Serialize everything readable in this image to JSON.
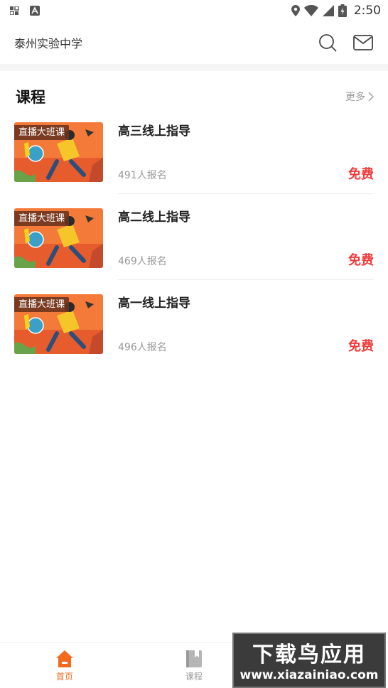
{
  "status_bar": {
    "time": "2:50"
  },
  "header": {
    "title": "泰州实验中学"
  },
  "section": {
    "title": "课程",
    "more_label": "更多"
  },
  "courses": [
    {
      "badge": "直播大班课",
      "title": "高三线上指导",
      "enrolled": "491人报名",
      "price": "免费"
    },
    {
      "badge": "直播大班课",
      "title": "高二线上指导",
      "enrolled": "469人报名",
      "price": "免费"
    },
    {
      "badge": "直播大班课",
      "title": "高一线上指导",
      "enrolled": "496人报名",
      "price": "免费"
    }
  ],
  "tab_bar": {
    "home_label": "首页",
    "courses_label": "课程"
  },
  "watermark": {
    "line1": "下载鸟应用",
    "line2": "www.xiazainiao.com"
  },
  "colors": {
    "accent": "#f26b1d",
    "price": "#f03c3c"
  },
  "icons": {
    "search": "search-icon",
    "message": "mail-icon",
    "more": "chevron-right-icon",
    "home": "home-icon",
    "courses": "book-icon"
  }
}
